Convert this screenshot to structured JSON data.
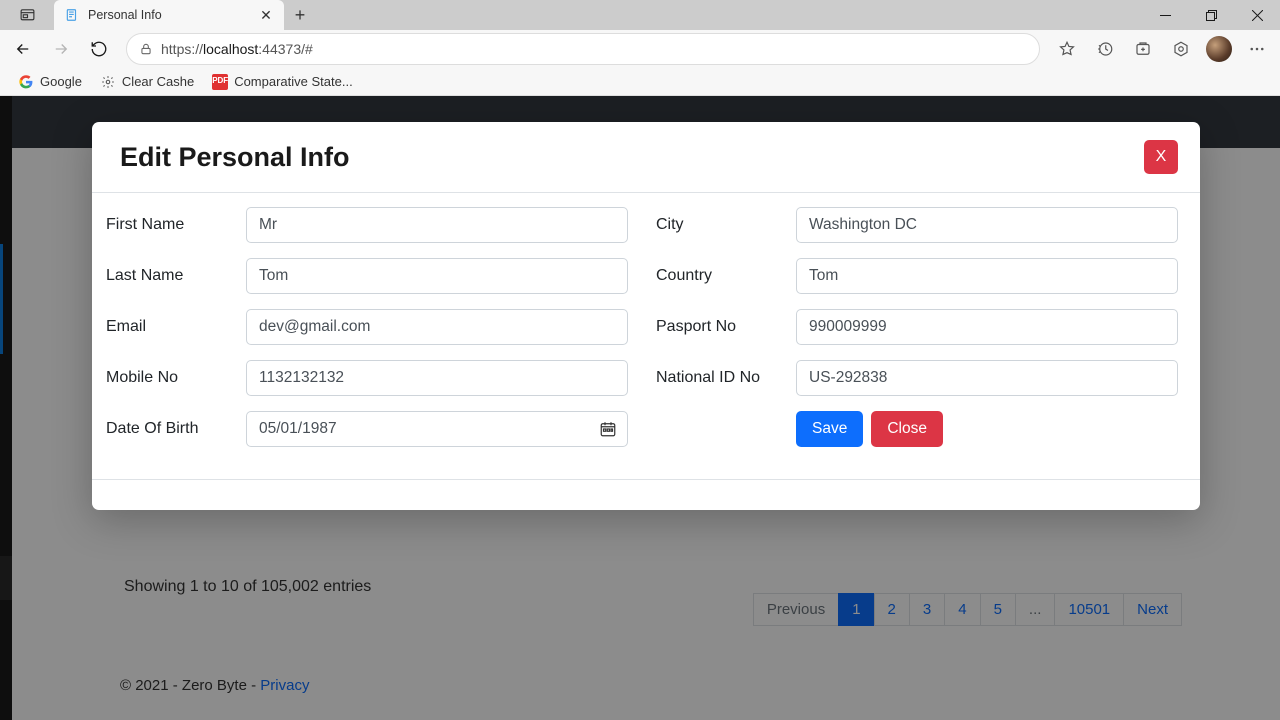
{
  "browser": {
    "tab_title": "Personal Info",
    "url_protocol": "https://",
    "url_host": "localhost",
    "url_port_path": ":44373/#",
    "bookmarks": [
      "Google",
      "Clear Cashe",
      "Comparative State..."
    ]
  },
  "page": {
    "entries_text": "Showing 1 to 10 of 105,002 entries",
    "pagination": {
      "prev": "Previous",
      "pages": [
        "1",
        "2",
        "3",
        "4",
        "5",
        "...",
        "10501"
      ],
      "next": "Next"
    },
    "footer_text": "© 2021 - Zero Byte - ",
    "footer_link": "Privacy"
  },
  "modal": {
    "title": "Edit Personal Info",
    "close_x": "X",
    "labels": {
      "first_name": "First Name",
      "last_name": "Last Name",
      "email": "Email",
      "mobile": "Mobile No",
      "dob": "Date Of Birth",
      "city": "City",
      "country": "Country",
      "passport": "Pasport No",
      "national_id": "National ID No"
    },
    "values": {
      "first_name": "Mr",
      "last_name": "Tom",
      "email": "dev@gmail.com",
      "mobile": "1132132132",
      "dob": "05/01/1987",
      "city": "Washington DC",
      "country": "Tom",
      "passport": "990009999",
      "national_id": "US-292838"
    },
    "buttons": {
      "save": "Save",
      "close": "Close"
    }
  }
}
